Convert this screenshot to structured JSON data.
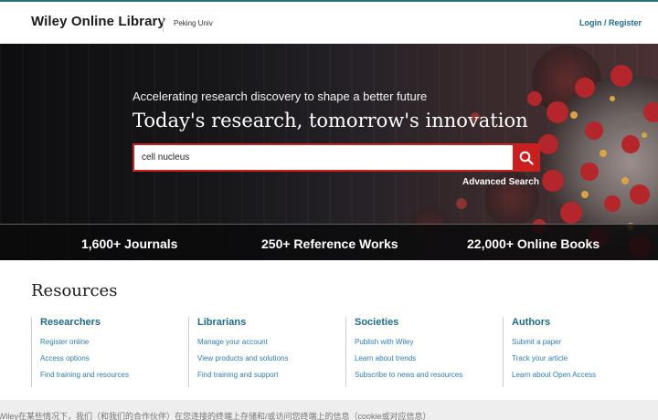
{
  "header": {
    "logo": "Wiley Online Library",
    "institution": "Peking Univ",
    "login": "Login / Register"
  },
  "hero": {
    "tagline": "Accelerating research discovery to shape a better future",
    "headline": "Today's research, tomorrow's innovation",
    "search": {
      "value": "cell nucleus",
      "button_icon": "search-icon"
    },
    "advanced_search": "Advanced Search"
  },
  "stats": [
    {
      "label": "1,600+ Journals"
    },
    {
      "label": "250+ Reference Works"
    },
    {
      "label": "22,000+ Online Books"
    }
  ],
  "resources": {
    "title": "Resources",
    "columns": [
      {
        "title": "Researchers",
        "links": [
          "Register online",
          "Access options",
          "Find training and resources"
        ]
      },
      {
        "title": "Librarians",
        "links": [
          "Manage your account",
          "View products and solutions",
          "Find training and support"
        ]
      },
      {
        "title": "Societies",
        "links": [
          "Publish with Wiley",
          "Learn about trends",
          "Subscribe to news and resources"
        ]
      },
      {
        "title": "Authors",
        "links": [
          "Submit a paper",
          "Track your article",
          "Learn about Open Access"
        ]
      }
    ]
  },
  "cookie_banner": {
    "text": "Wiley在某些情况下，我们（和我们的合作伙伴）在您连接的终端上存储和/或访问您终端上的信息（cookie或对应信息）"
  },
  "colors": {
    "accent": "#1e6b86",
    "search_red": "#c9201f",
    "hero_bg": "#18181b"
  }
}
